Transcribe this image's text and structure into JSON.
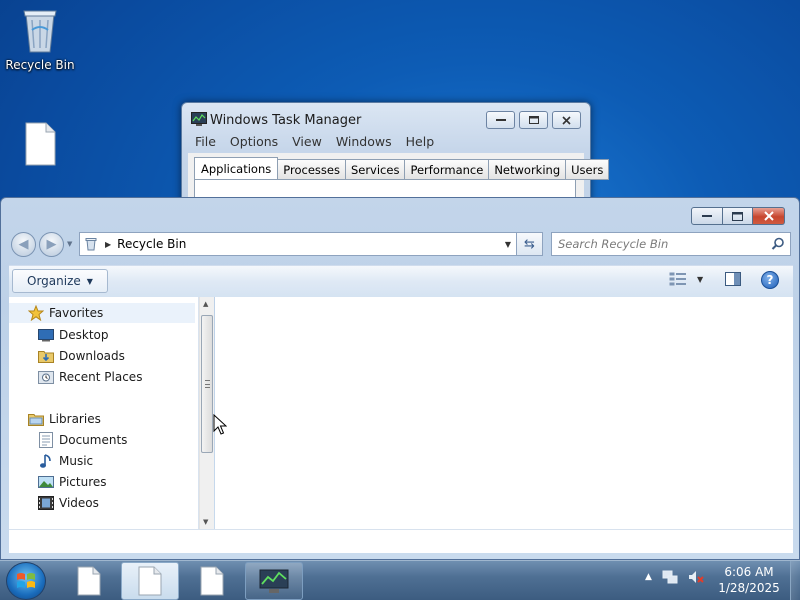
{
  "desktop": {
    "icons": [
      {
        "label": "Recycle Bin",
        "icon": "recycle-bin-icon"
      },
      {
        "label": "",
        "icon": "file-icon"
      }
    ]
  },
  "task_manager": {
    "title": "Windows Task Manager",
    "menu": [
      "File",
      "Options",
      "View",
      "Windows",
      "Help"
    ],
    "tabs": [
      "Applications",
      "Processes",
      "Services",
      "Performance",
      "Networking",
      "Users"
    ],
    "active_tab": "Applications"
  },
  "explorer": {
    "address": {
      "location": "Recycle Bin"
    },
    "search": {
      "placeholder": "Search Recycle Bin"
    },
    "toolbar": {
      "organize_label": "Organize"
    },
    "nav": {
      "favorites": {
        "label": "Favorites",
        "items": [
          {
            "label": "Desktop",
            "icon": "desktop-icon"
          },
          {
            "label": "Downloads",
            "icon": "downloads-folder-icon"
          },
          {
            "label": "Recent Places",
            "icon": "recent-places-icon"
          }
        ]
      },
      "libraries": {
        "label": "Libraries",
        "items": [
          {
            "label": "Documents",
            "icon": "documents-icon"
          },
          {
            "label": "Music",
            "icon": "music-icon"
          },
          {
            "label": "Pictures",
            "icon": "pictures-icon"
          },
          {
            "label": "Videos",
            "icon": "videos-icon"
          }
        ]
      }
    }
  },
  "taskbar": {
    "clock": {
      "time": "6:06 AM",
      "date": "1/28/2025"
    }
  },
  "colors": {
    "desktop_bg": "#0d5cb5",
    "window_frame": "#c3d5ea",
    "close_button": "#c7462f",
    "taskbar": "#4f7094"
  }
}
